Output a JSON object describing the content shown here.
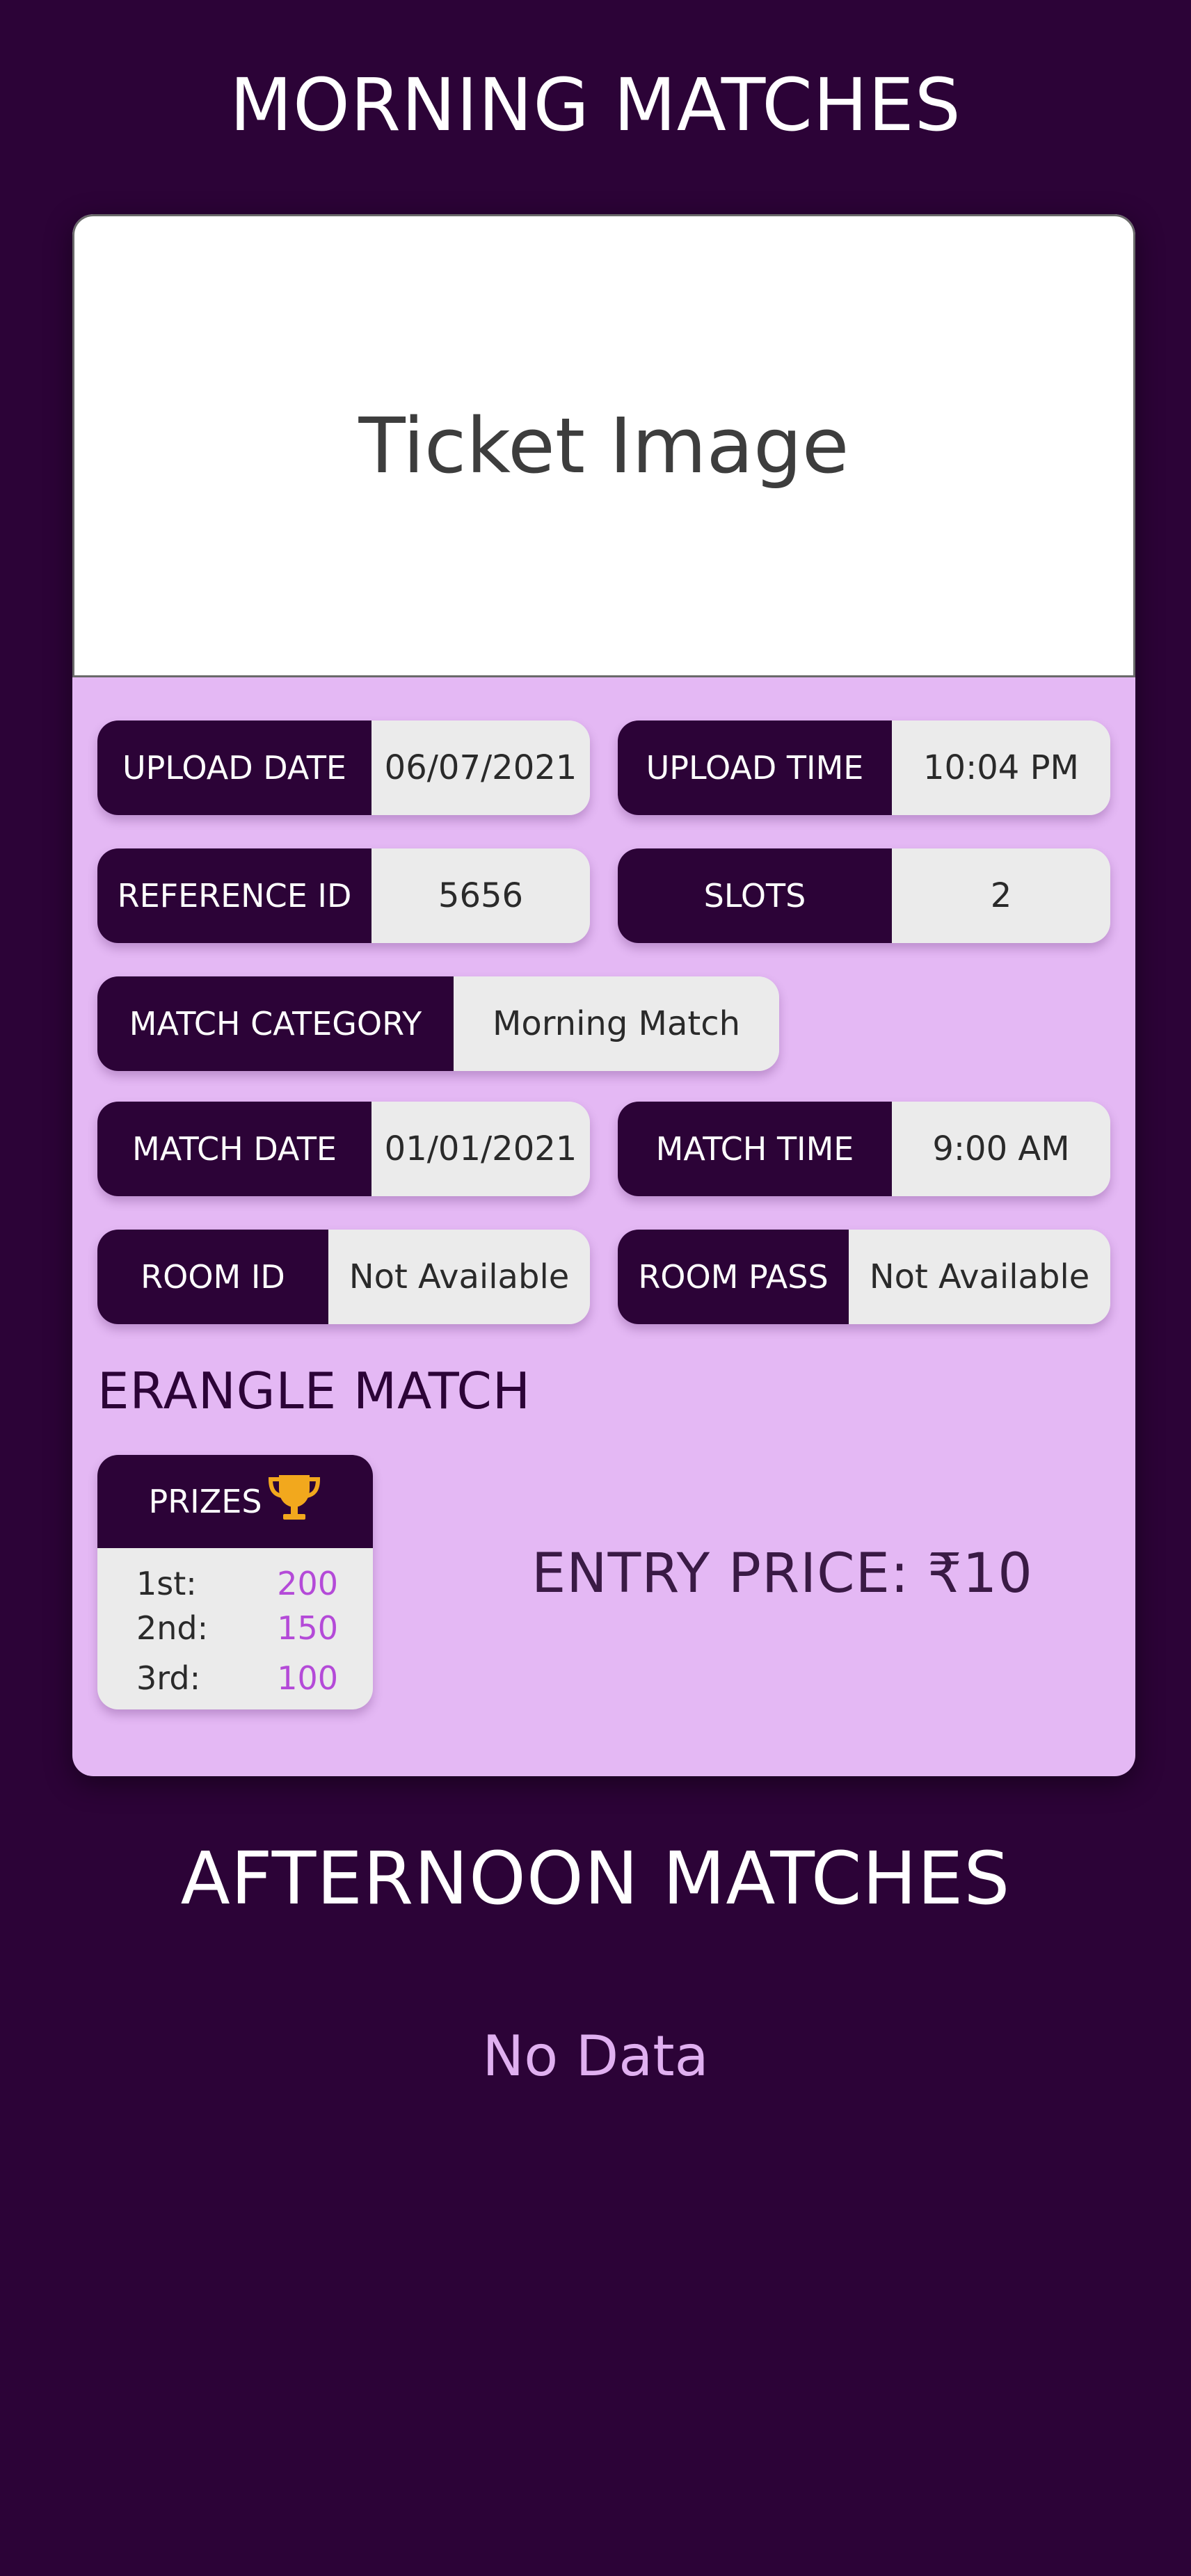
{
  "morning": {
    "title": "MORNING MATCHES",
    "ticket_image_text": "Ticket Image",
    "fields": {
      "upload_date": {
        "label": "UPLOAD DATE",
        "value": "06/07/2021"
      },
      "upload_time": {
        "label": "UPLOAD TIME",
        "value": "10:04 PM"
      },
      "reference_id": {
        "label": "REFERENCE ID",
        "value": "5656"
      },
      "slots": {
        "label": "SLOTS",
        "value": "2"
      },
      "match_category": {
        "label": "MATCH CATEGORY",
        "value": "Morning Match"
      },
      "match_date": {
        "label": "MATCH DATE",
        "value": "01/01/2021"
      },
      "match_time": {
        "label": "MATCH TIME",
        "value": "9:00 AM"
      },
      "room_id": {
        "label": "ROOM ID",
        "value": "Not Available"
      },
      "room_pass": {
        "label": "ROOM PASS",
        "value": "Not Available"
      }
    },
    "match_name": "ERANGLE MATCH",
    "prizes": {
      "label": "PRIZES",
      "icon": "trophy-icon",
      "rows": [
        {
          "place": "1st:",
          "amount": "200"
        },
        {
          "place": "2nd:",
          "amount": "150"
        },
        {
          "place": "3rd:",
          "amount": "100"
        }
      ]
    },
    "entry_price": "ENTRY PRICE: ₹10"
  },
  "afternoon": {
    "title": "AFTERNOON MATCHES",
    "empty_text": "No Data"
  },
  "colors": {
    "background": "#2c0337",
    "card": "#e4b8f4",
    "pill_value": "#ebebeb",
    "prize_amount": "#b44ad8",
    "trophy": "#f2a81d",
    "no_data": "#e0b0f0"
  }
}
